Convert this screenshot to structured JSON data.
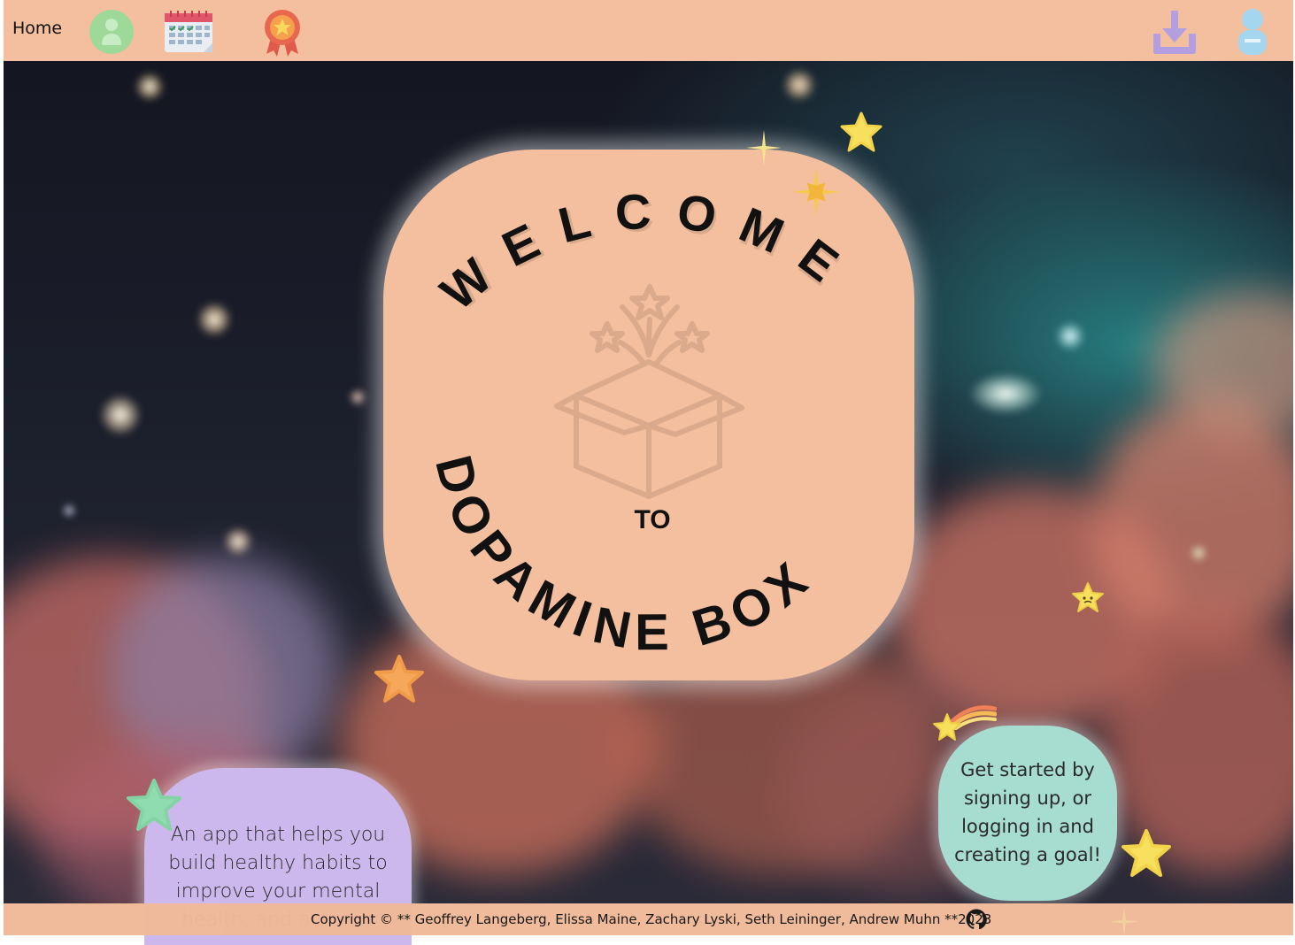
{
  "nav": {
    "home_label": "Home",
    "icons": [
      "user-profile-icon",
      "calendar-icon",
      "award-ribbon-icon",
      "download-icon",
      "user-remove-icon"
    ]
  },
  "welcome": {
    "line1": "WELCOME",
    "line2": "TO",
    "line3": "DOPAMINE BOX",
    "logo": "gift-box-stars-icon"
  },
  "info": {
    "purple_text": "An app that helps you build healthy habits to improve your mental health, and achieve",
    "teal_text": "Get started by signing up, or logging in and creating a goal!"
  },
  "footer": {
    "copyright": "Copyright © ** Geoffrey Langeberg, Elissa Maine, Zachary Lyski, Seth Leininger, Andrew Muhn **2023",
    "github_icon": "github-icon"
  },
  "colors": {
    "nav_bg": "#f4bf9e",
    "card_peach": "#f4bf9e",
    "card_purple": "#cdb8ed",
    "card_teal": "#a7ddd0",
    "star_yellow": "#f6e05e",
    "star_orange": "#f5a85a",
    "star_green": "#8fdcb0"
  }
}
